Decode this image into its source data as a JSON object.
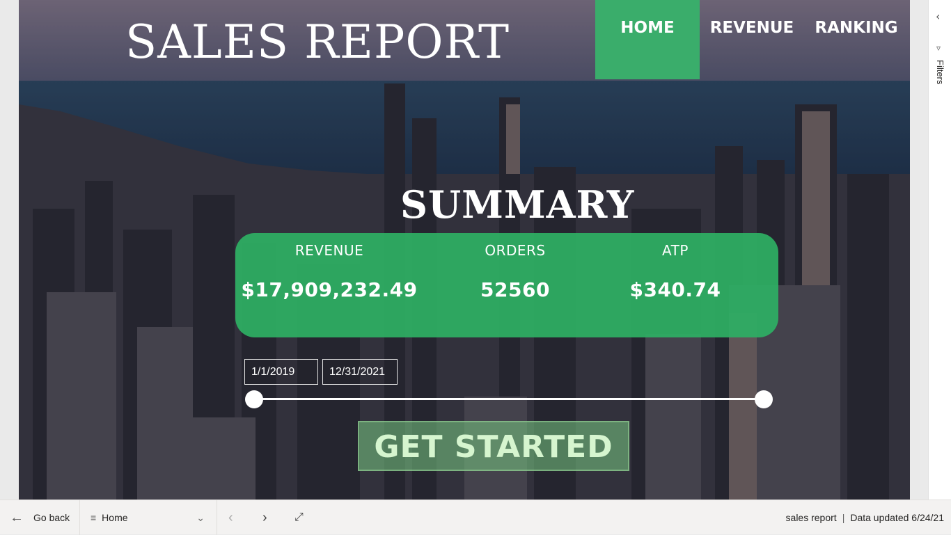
{
  "report": {
    "title": "SALES REPORT"
  },
  "nav": {
    "items": [
      "HOME",
      "REVENUE",
      "RANKING"
    ],
    "active": "HOME"
  },
  "summary": {
    "title": "SUMMARY",
    "kpis": [
      {
        "label": "REVENUE",
        "value": "$17,909,232.49"
      },
      {
        "label": "ORDERS",
        "value": "52560"
      },
      {
        "label": "ATP",
        "value": "$340.74"
      }
    ]
  },
  "date_slicer": {
    "start": "1/1/2019",
    "end": "12/31/2021"
  },
  "cta": {
    "label": "GET STARTED"
  },
  "filters_pane": {
    "label": "Filters",
    "collapse_icon": "chevron-left-icon",
    "filter_icon": "funnel-icon"
  },
  "bottom_bar": {
    "go_back": "Go back",
    "page": "Home",
    "report_name": "sales report",
    "separator": "|",
    "data_updated": "Data updated 6/24/21"
  },
  "colors": {
    "accent_green": "#3aad6b",
    "card_green": "#2eb064",
    "cta_text": "#d6f5cf"
  }
}
